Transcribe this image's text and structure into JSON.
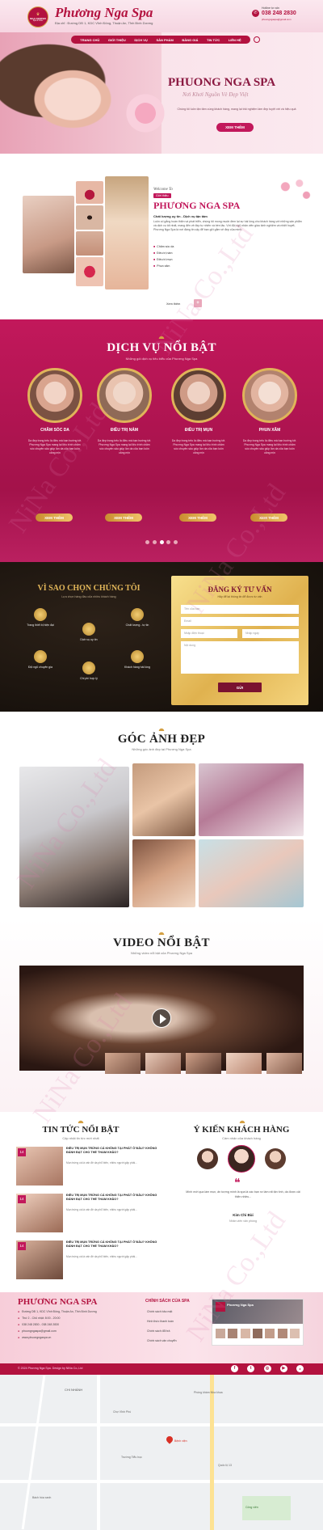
{
  "header": {
    "logo_top": "NGA CENTER",
    "logo_bottom": "Spa & Clinic",
    "brand": "Phương Nga Spa",
    "address": "Địa chỉ : Đường DĐ 1, KDC Vĩnh Đông, Thuận An, Tỉnh Bình Dương",
    "hotline_label": "Hotline tư vấn",
    "hotline": "038 248 2830",
    "email": "phuongngaspa@gmail.com"
  },
  "nav": {
    "items": [
      "TRANG CHỦ",
      "GIỚI THIỆU",
      "DỊCH VỤ",
      "SẢN PHẨM",
      "BẢNG GIÁ",
      "TIN TỨC",
      "LIÊN HỆ"
    ]
  },
  "hero": {
    "title": "PHUONG NGA SPA",
    "script": "Nơi Khơi Nguồn Vẻ Đẹp Việt",
    "desc": "Chúng tôi luôn tận tâm cùng khách hàng, mang lại trải nghiệm làm đẹp tuyệt vời và hiệu quả",
    "button": "XEM THÊM"
  },
  "about": {
    "welcome": "Welcome To",
    "tag": "Giới thiệu",
    "title": "PHƯƠNG NGA SPA",
    "tagline": "Chất lượng uy tín - Dịch vụ tận tâm",
    "body": "Luôn cố gắng hoàn thiện và phát triển, chúng tôi mong muốn đem lại sự hài lòng cho khách hàng với những sản phẩm và dịch vụ tốt nhất, mang đến vẻ đẹp tự nhiên và bền lâu. Với đội ngũ nhân viên giàu kinh nghiệm và nhiệt huyết, Phương Nga Spa là nơi đáng tin cậy để bạn gửi gắm vẻ đẹp của mình.",
    "bullets": [
      "Chăm sóc da",
      "Điều trị nám",
      "Điều trị mụn",
      "Phun xăm"
    ],
    "more": "Xem thêm",
    "plus": "+"
  },
  "services": {
    "title": "DỊCH VỤ NỔI BẬT",
    "subtitle": "Những gói dịch vụ tiêu biểu của Phương Nga Spa",
    "items": [
      {
        "name": "CHĂM SÓC DA",
        "desc": "Da đẹp trong trẻo là điều mà bạn hướng tới. Phương Nga Spa mang lại liệu trình chăm sóc chuyên sâu giúp làn da của bạn luôn căng mịn",
        "button": "XEM THÊM"
      },
      {
        "name": "ĐIỀU TRỊ NÁM",
        "desc": "Da đẹp trong trẻo là điều mà bạn hướng tới. Phương Nga Spa mang lại liệu trình chăm sóc chuyên sâu giúp làn da của bạn luôn căng mịn",
        "button": "XEM THÊM"
      },
      {
        "name": "ĐIỀU TRỊ MỤN",
        "desc": "Da đẹp trong trẻo là điều mà bạn hướng tới. Phương Nga Spa mang lại liệu trình chăm sóc chuyên sâu giúp làn da của bạn luôn căng mịn",
        "button": "XEM THÊM"
      },
      {
        "name": "PHUN XĂM",
        "desc": "Da đẹp trong trẻo là điều mà bạn hướng tới. Phương Nga Spa mang lại liệu trình chăm sóc chuyên sâu giúp làn da của bạn luôn căng mịn",
        "button": "XEM THÊM"
      }
    ]
  },
  "why": {
    "title": "VÌ SAO CHỌN CHÚNG TÔI",
    "subtitle": "Lựa chọn hàng đầu của nhiều khách hàng",
    "items": [
      "Trang thiết bị hiện đại",
      "Dịch vụ uy tín",
      "Chất lượng - tự tin",
      "Đội ngũ chuyên gia",
      "Chi phí hợp lý",
      "Khách hàng hài lòng"
    ]
  },
  "register": {
    "title": "ĐĂNG KÝ TƯ VẤN",
    "subtitle": "Hãy để lại thông tin để được tư vấn",
    "name_ph": "Tên của bạn",
    "email_ph": "Email",
    "phone_ph": "Nhập điện thoại",
    "topic_ph": "Nhập ngày",
    "message_ph": "Nội dung",
    "button": "GỬI"
  },
  "gallery": {
    "title": "GÓC ẢNH ĐẸP",
    "subtitle": "Những góc ảnh đẹp tại Phương Nga Spa"
  },
  "video": {
    "title": "VIDEO NỔI BẬT",
    "subtitle": "Những video nổi bật của Phương Nga Spa"
  },
  "news": {
    "title": "TIN TỨC NỔI BẬT",
    "subtitle": "Cập nhật tin tức mới nhất",
    "items": [
      {
        "day": "14",
        "title": "ĐIỀU TRỊ MỤN TRỨNG CÁ KHÔNG TẠI PHÁT Ở ĐÂU? KHÔNG ĐÁNH ĐẠT CHO THỂ THAM KHẢO?",
        "desc": "Mụn trứng cá là vấn đề da phổ biến, nhiều người gặp phải..."
      },
      {
        "day": "14",
        "title": "ĐIỀU TRỊ MỤN TRỨNG CÁ KHÔNG TẠI PHÁT Ở ĐÂU? KHÔNG ĐÁNH ĐẠT CHO THỂ THAM KHẢO?",
        "desc": "Mụn trứng cá là vấn đề da phổ biến, nhiều người gặp phải..."
      },
      {
        "day": "14",
        "title": "ĐIỀU TRỊ MỤN TRỨNG CÁ KHÔNG TẠI PHÁT Ở ĐÂU? KHÔNG ĐÁNH ĐẠT CHO THỂ THAM KHẢO?",
        "desc": "Mụn trứng cá là vấn đề da phổ biến, nhiều người gặp phải..."
      }
    ]
  },
  "testimonials": {
    "title": "Ý KIẾN KHÁCH HÀNG",
    "subtitle": "Cảm nhận của khách hàng",
    "quote": "Mình mới qua làm mụn, ấn tượng mình là spa là các bạn nv làm rất tận tình, da được cải thiện nhiều...",
    "name": "Kim Chi Bùi",
    "role": "Nhân viên văn phòng"
  },
  "footer": {
    "brand": "PHƯƠNG NGA SPA",
    "address": "Đường DĐ 1, KDC Vĩnh Đông, Thuận An, Tỉnh Bình Dương",
    "hours": "Thứ 2 - Chủ nhật: 8:00 - 20:00",
    "phone": "038 248 2830 - 038 248 2830",
    "email": "phuongngaspa@gmail.com",
    "web": "www.phuongngaspa.vn",
    "policy_title": "CHÍNH SÁCH CỦA SPA",
    "policies": [
      "Chính sách bảo mật",
      "Hình thức thanh toán",
      "Chính sách đổi trả",
      "Chính sách vận chuyển"
    ],
    "fanpage": "Phương Nga Spa",
    "copyright": "© 2024 Phương Nga Spa. Design by NiNa Co.,Ltd"
  },
  "map": {
    "labels": [
      "CHI NHÁNH",
      "Phòng khám Nha khoa",
      "Chợ Vĩnh Phú",
      "Bệnh viện",
      "Trường Tiểu học",
      "Quốc lộ 13",
      "Bách hóa xanh",
      "Công viên"
    ]
  },
  "watermark": "NiNa Co.,Ltd",
  "colors": {
    "pink": "#c2185b",
    "gold": "#d4a043",
    "dark": "#1a1410",
    "rose": "#e8a7b8"
  }
}
